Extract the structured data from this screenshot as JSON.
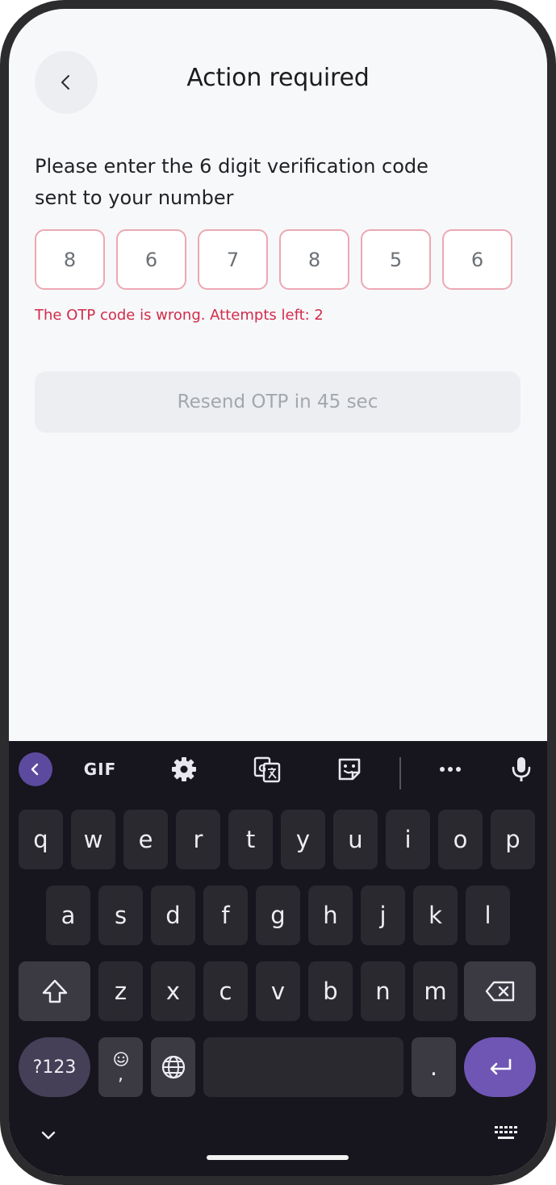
{
  "header": {
    "title": "Action required",
    "back_icon": "chevron-left-icon"
  },
  "instruction": {
    "line1": "Please enter the 6 digit verification code",
    "line2": "sent to your number"
  },
  "otp": {
    "digits": [
      "8",
      "6",
      "7",
      "8",
      "5",
      "6"
    ],
    "error_message": "The OTP code is wrong. Attempts left: 2",
    "border_color": "#eca8b3"
  },
  "resend": {
    "label": "Resend OTP in 45 sec"
  },
  "keyboard": {
    "toolbar": {
      "gif_label": "GIF",
      "icons": [
        "chevron-left-icon",
        "gear-icon",
        "translate-icon",
        "sticker-icon",
        "more-icon",
        "microphone-icon"
      ]
    },
    "row1": [
      "q",
      "w",
      "e",
      "r",
      "t",
      "y",
      "u",
      "i",
      "o",
      "p"
    ],
    "row2": [
      "a",
      "s",
      "d",
      "f",
      "g",
      "h",
      "j",
      "k",
      "l"
    ],
    "row3": [
      "z",
      "x",
      "c",
      "v",
      "b",
      "n",
      "m"
    ],
    "symbols_label": "?123",
    "comma_label": ",",
    "period_label": ".",
    "accent_color": "#6f56b4"
  },
  "colors": {
    "error": "#d22b4a",
    "background": "#f7f8fa",
    "keyboard_bg": "#17151d"
  }
}
